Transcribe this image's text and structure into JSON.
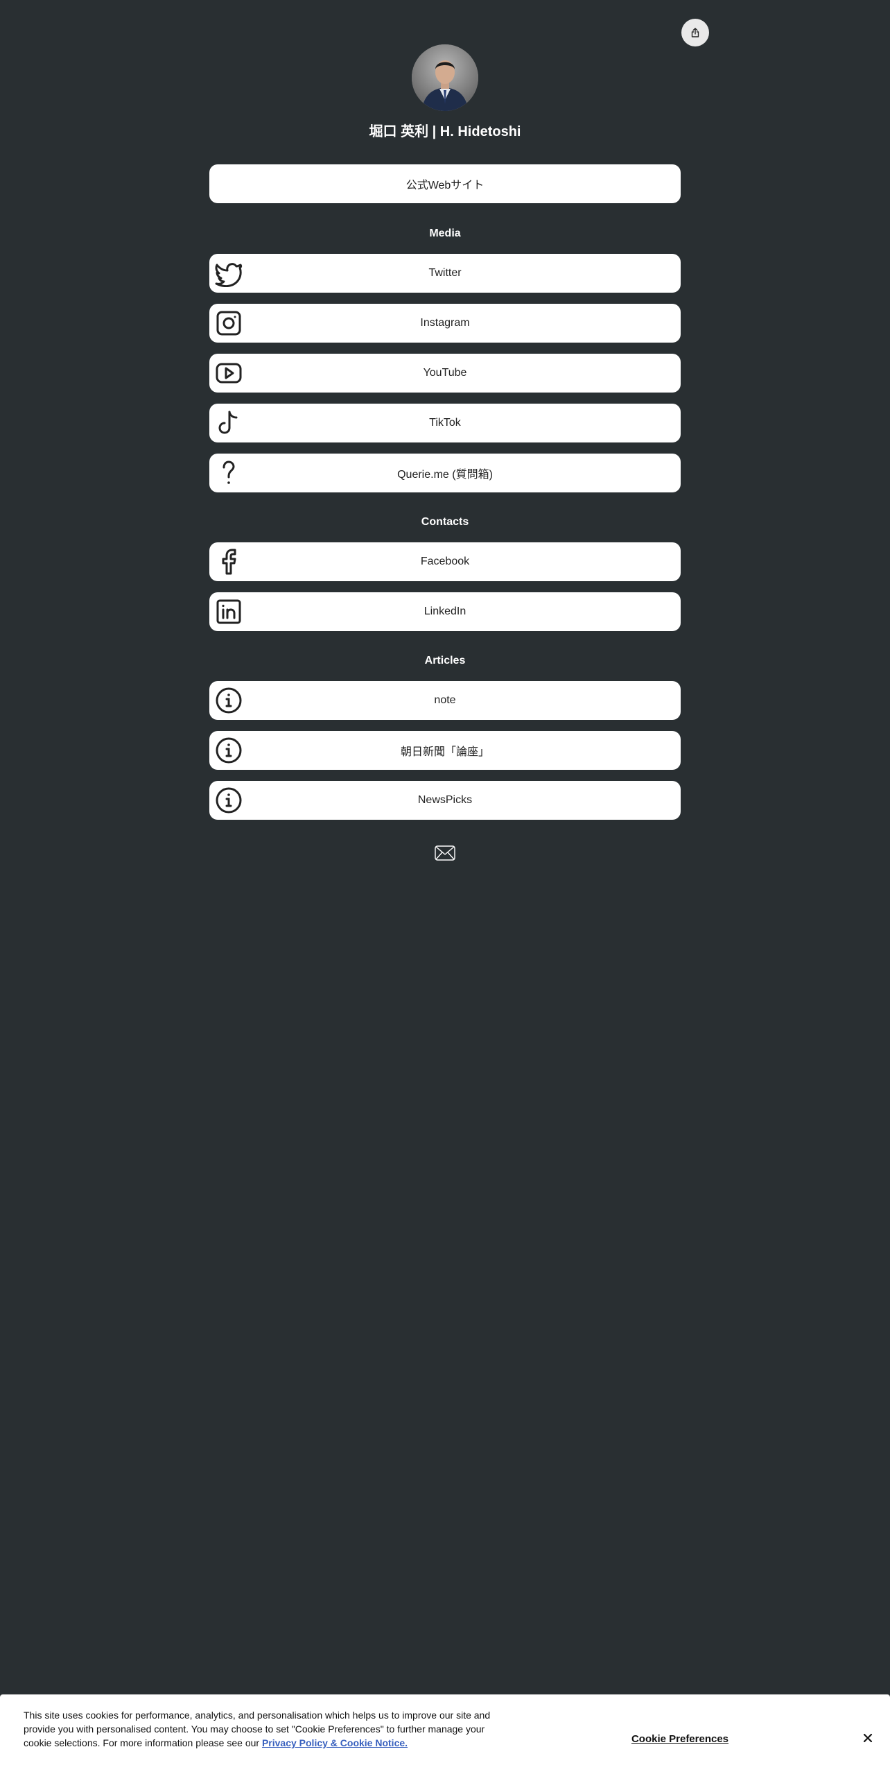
{
  "profile": {
    "name": "堀口 英利 | H. Hidetoshi"
  },
  "links_top": [
    {
      "label": "公式Webサイト",
      "icon": "none"
    }
  ],
  "sections": {
    "media": {
      "title": "Media",
      "links": [
        {
          "label": "Twitter",
          "icon": "twitter-icon"
        },
        {
          "label": "Instagram",
          "icon": "instagram-icon"
        },
        {
          "label": "YouTube",
          "icon": "youtube-icon"
        },
        {
          "label": "TikTok",
          "icon": "tiktok-icon"
        },
        {
          "label": "Querie.me (質問箱)",
          "icon": "question-icon"
        }
      ]
    },
    "contacts": {
      "title": "Contacts",
      "links": [
        {
          "label": "Facebook",
          "icon": "facebook-icon"
        },
        {
          "label": "LinkedIn",
          "icon": "linkedin-icon"
        }
      ]
    },
    "articles": {
      "title": "Articles",
      "links": [
        {
          "label": "note",
          "icon": "info-icon"
        },
        {
          "label": "朝日新聞「論座」",
          "icon": "info-icon"
        },
        {
          "label": "NewsPicks",
          "icon": "info-icon"
        }
      ]
    }
  },
  "icons": {
    "share": "share-icon",
    "mail": "mail-icon",
    "close": "close-icon"
  },
  "cookie_banner": {
    "text": "This site uses cookies for performance, analytics, and personalisation which helps us to improve our site and provide you with personalised content. You may choose to set \"Cookie Preferences\" to further manage your cookie selections. For more information please see our ",
    "link_label": "Privacy Policy & Cookie Notice.",
    "preferences_label": "Cookie Preferences"
  },
  "colors": {
    "background": "#292f32",
    "button": "#ffffff",
    "button_text": "#222222",
    "link": "#3860be"
  }
}
